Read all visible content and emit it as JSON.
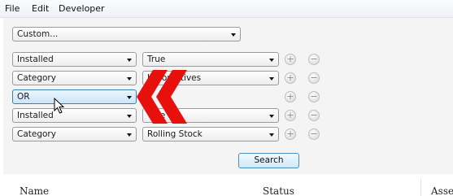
{
  "menubar": {
    "items": [
      "File",
      "Edit",
      "Developer"
    ]
  },
  "preset": {
    "value": "Custom..."
  },
  "filters": [
    {
      "field": "Installed",
      "value": "True"
    },
    {
      "field": "Category",
      "value": "Locomotives"
    },
    {
      "field": "OR",
      "value": ""
    },
    {
      "field": "Installed",
      "value": "True"
    },
    {
      "field": "Category",
      "value": "Rolling Stock"
    }
  ],
  "add_symbol": "+",
  "remove_symbol": "−",
  "search": {
    "label": "Search"
  },
  "table": {
    "columns": [
      "Name",
      "Status",
      "Asse"
    ]
  },
  "overlay": {
    "icon": "double-chevron-left-icon",
    "color": "#e8100c"
  },
  "colors": {
    "hover_border": "#3c7fb1",
    "accent": "#4a8dc2"
  }
}
